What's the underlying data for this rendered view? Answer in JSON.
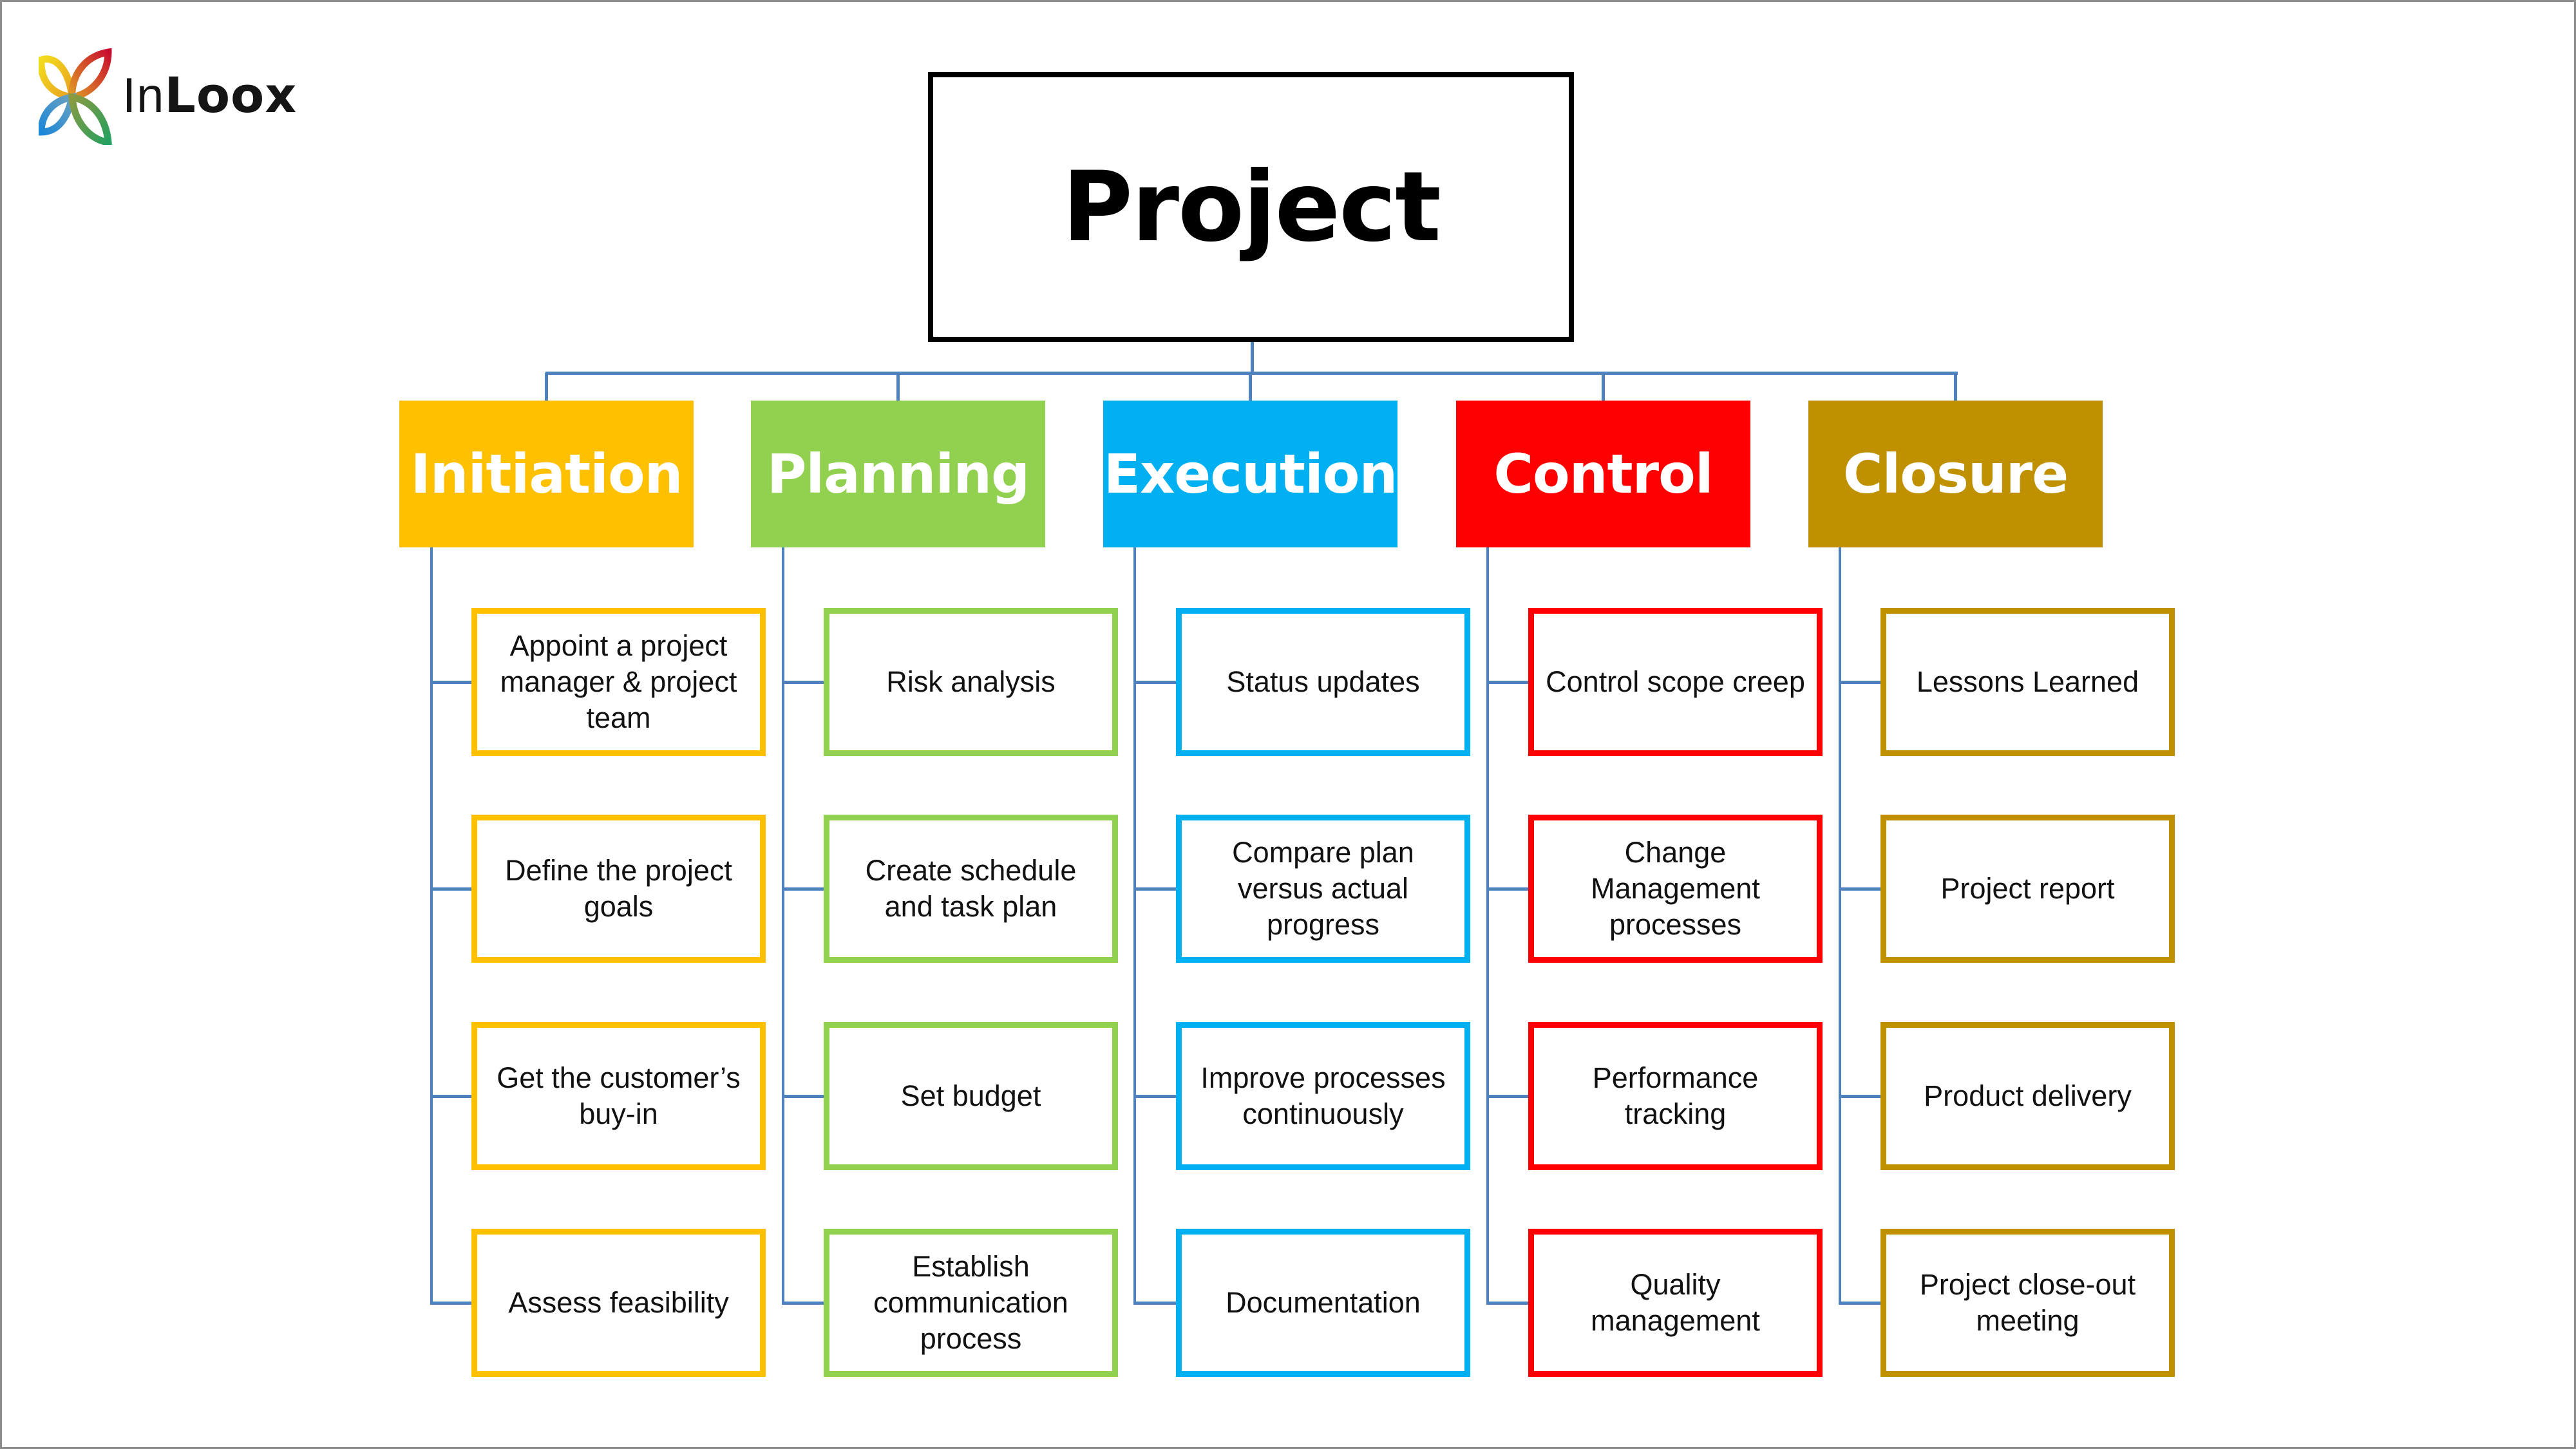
{
  "logo": {
    "brand_light": "In",
    "brand_bold": "Loox"
  },
  "root": {
    "label": "Project"
  },
  "colors": {
    "connector": "#4f81bd",
    "root_border": "#000000"
  },
  "phases": [
    {
      "label": "Initiation",
      "color": "#FFC000",
      "tasks": [
        "Appoint a project manager & project team",
        "Define the project goals",
        "Get the customer’s buy-in",
        "Assess feasibility"
      ]
    },
    {
      "label": "Planning",
      "color": "#92D050",
      "tasks": [
        "Risk analysis",
        "Create schedule and task plan",
        "Set budget",
        "Establish communication process"
      ]
    },
    {
      "label": "Execution",
      "color": "#00B0F0",
      "tasks": [
        "Status updates",
        "Compare plan versus actual progress",
        "Improve processes continuously",
        "Documentation"
      ]
    },
    {
      "label": "Control",
      "color": "#FF0000",
      "tasks": [
        "Control scope creep",
        "Change Management processes",
        "Performance tracking",
        "Quality management"
      ]
    },
    {
      "label": "Closure",
      "color": "#BF9000",
      "tasks": [
        "Lessons Learned",
        "Project report",
        "Product delivery",
        "Project close-out meeting"
      ]
    }
  ]
}
